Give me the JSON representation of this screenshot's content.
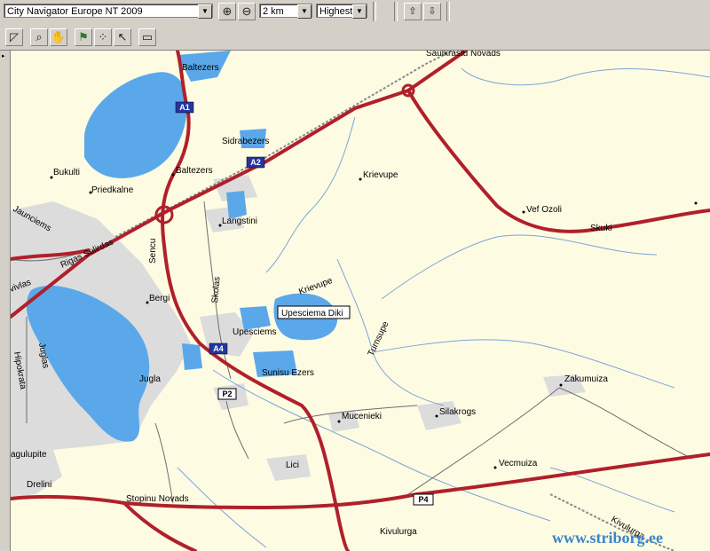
{
  "toolbar": {
    "map_product": "City Navigator Europe NT 2009",
    "scale": "2 km",
    "detail": "Highest"
  },
  "tools": {
    "zoom_in": "zoom-in-icon",
    "zoom_out": "zoom-out-icon",
    "send_to_device": "send-to-device-icon",
    "receive_from_device": "receive-from-device-icon",
    "selection": "selection-tool-icon",
    "zoom": "zoom-tool-icon",
    "hand": "hand-tool-icon",
    "waypoint": "waypoint-tool-icon",
    "route": "route-tool-icon",
    "pointer": "pointer-tool-icon",
    "measure": "measure-tool-icon"
  },
  "colors": {
    "background": "#fefbe3",
    "water": "#5aa8ea",
    "urban": "#dcdcdc",
    "major_road": "#b0202a",
    "minor_road": "#6d6d6d",
    "stream": "#7aa5d6",
    "shield": "#2336a4"
  },
  "map": {
    "shields": {
      "a1": "A1",
      "a2": "A2",
      "a4": "A4",
      "p2": "P2",
      "p4": "P4"
    },
    "labels": {
      "saulkrasti": "Saulkrastu Novads",
      "baltezers_top": "Baltezers",
      "sidrabezers": "Sidrabezers",
      "baltezers": "Baltezers",
      "bukulti": "Bukulti",
      "priedkalne": "Priedkalne",
      "jaunciems": "Jaunciems",
      "langstini": "Langstini",
      "krievupe": "Krievupe",
      "krievupe_river": "Krievupe",
      "vef_ozoli": "Vef Ozoli",
      "skuki": "Skuki",
      "rigas_sulirdas": "Rigas Sulirdas",
      "sencu": "Sencu",
      "skolas": "Skolas",
      "bergi": "Bergi",
      "upesciema_diki": "Upesciema Diki",
      "upesciems": "Upesciems",
      "turnsupe": "Turnsupe",
      "jugla": "Jugla",
      "sunisu_ezers": "Sunisu Ezers",
      "zakumuiza": "Zakumuiza",
      "juglas": "Juglas",
      "hipokrata": "Hipokrata",
      "mucenieki": "Mucenieki",
      "silakrogs": "Silakrogs",
      "vecmuiza": "Vecmuiza",
      "jugulupite": "agulupite",
      "lici": "Lici",
      "drelini": "Drelini",
      "stopinu": "Stopinu Novads",
      "kivulurga": "Kivulurga",
      "vivlas": "vivlas",
      "kivulurga_rail": "Kivulurga"
    },
    "watermark": "www.striborg.ee"
  }
}
